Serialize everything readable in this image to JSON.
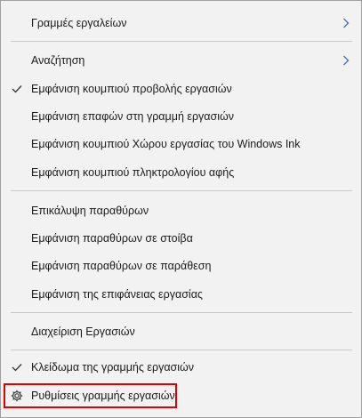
{
  "menu": {
    "items": [
      {
        "label": "Γραμμές εργαλείων",
        "checked": false,
        "submenu": true
      },
      {
        "label": "Αναζήτηση",
        "checked": false,
        "submenu": true
      },
      {
        "label": "Εμφάνιση κουμπιού προβολής εργασιών",
        "checked": true,
        "submenu": false
      },
      {
        "label": "Εμφάνιση επαφών στη γραμμή εργασιών",
        "checked": false,
        "submenu": false
      },
      {
        "label": "Εμφάνιση κουμπιού Χώρου εργασίας του Windows Ink",
        "checked": false,
        "submenu": false
      },
      {
        "label": "Εμφάνιση κουμπιού πληκτρολογίου αφής",
        "checked": false,
        "submenu": false
      },
      {
        "label": "Επικάλυψη παραθύρων",
        "checked": false,
        "submenu": false
      },
      {
        "label": "Εμφάνιση παραθύρων σε στοίβα",
        "checked": false,
        "submenu": false
      },
      {
        "label": "Εμφάνιση παραθύρων σε παράθεση",
        "checked": false,
        "submenu": false
      },
      {
        "label": "Εμφάνιση της επιφάνειας εργασίας",
        "checked": false,
        "submenu": false
      },
      {
        "label": "Διαχείριση Εργασιών",
        "checked": false,
        "submenu": false
      },
      {
        "label": "Κλείδωμα της γραμμής εργασιών",
        "checked": true,
        "submenu": false
      },
      {
        "label": "Ρυθμίσεις γραμμής εργασιών",
        "checked": false,
        "submenu": false,
        "icon": "gear-icon",
        "highlighted": true
      }
    ]
  },
  "colors": {
    "menu_background": "#f2f2f2",
    "separator": "#c8c8c8",
    "highlight_border": "#e00000",
    "text": "#1b1b1b"
  }
}
